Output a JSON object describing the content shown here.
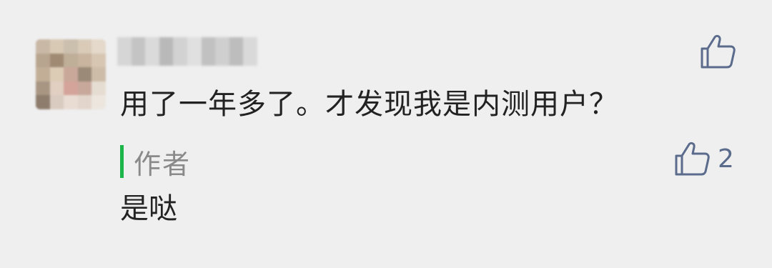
{
  "comment": {
    "text": "用了一年多了。才发现我是内测用户？",
    "like_icon": "thumbs-up-icon"
  },
  "reply": {
    "author_label": "作者",
    "text": "是哒",
    "like_icon": "thumbs-up-icon",
    "like_count": "2"
  },
  "colors": {
    "background": "#efefef",
    "author_accent": "#1bb54a",
    "icon_color": "#5b6b8c",
    "muted_text": "#8a8a8a"
  }
}
